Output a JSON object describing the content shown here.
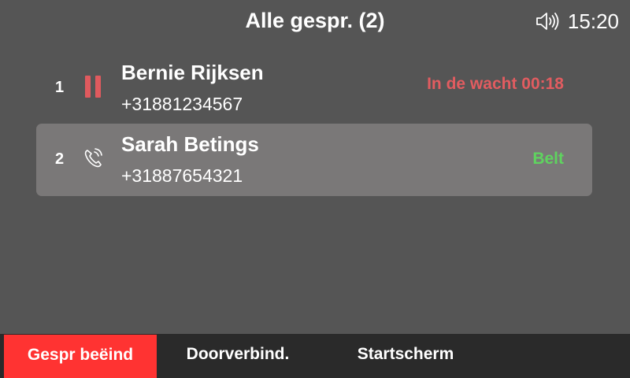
{
  "header": {
    "title": "Alle gespr. (2)",
    "time": "15:20",
    "volume_icon": "speaker-volume-icon"
  },
  "calls": [
    {
      "index": "1",
      "name": "Bernie Rijksen",
      "number": "+31881234567",
      "status": "In de wacht 00:18",
      "icon": "pause-icon",
      "selected": false
    },
    {
      "index": "2",
      "name": "Sarah Betings",
      "number": "+31887654321",
      "status": "Belt",
      "icon": "ringing-phone-icon",
      "selected": true
    }
  ],
  "softkeys": [
    "Gespr beëind",
    "Doorverbind.",
    "Startscherm"
  ],
  "colors": {
    "background": "#555555",
    "selected_row": "#7a7878",
    "hold_status": "#e25c60",
    "ringing_status": "#5fd35f",
    "end_call_key": "#ff3332",
    "softkey_bar": "#2a2a2a"
  }
}
